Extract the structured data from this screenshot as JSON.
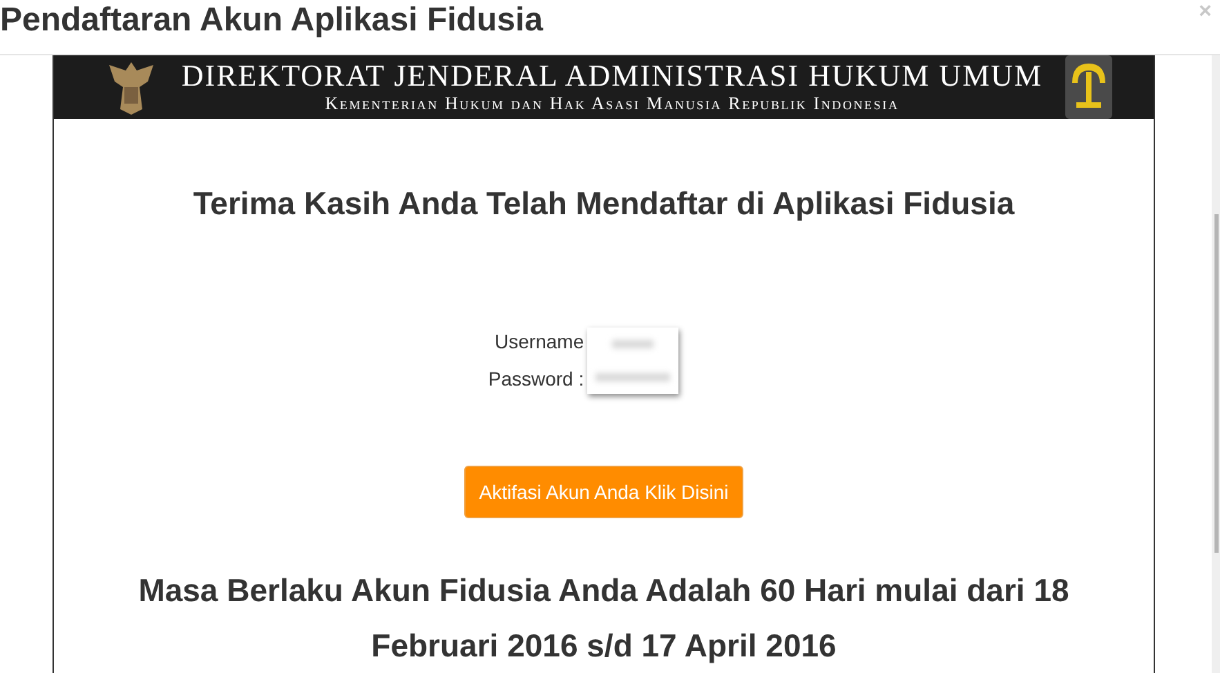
{
  "dialog": {
    "title": "Pendaftaran Akun Aplikasi Fidusia",
    "close": "×"
  },
  "banner": {
    "title": "DIREKTORAT JENDERAL ADMINISTRASI HUKUM UMUM",
    "subtitle": "Kementerian Hukum dan Hak Asasi Manusia Republik Indonesia"
  },
  "heading": "Terima Kasih Anda Telah Mendaftar di Aplikasi Fidusia",
  "credentials": [
    {
      "label": "Username"
    },
    {
      "label": "Password :"
    }
  ],
  "activate_button": "Aktifasi Akun Anda Klik Disini",
  "validity": "Masa Berlaku Akun Fidusia Anda Adalah 60 Hari mulai dari 18 Februari 2016 s/d 17 April 2016"
}
